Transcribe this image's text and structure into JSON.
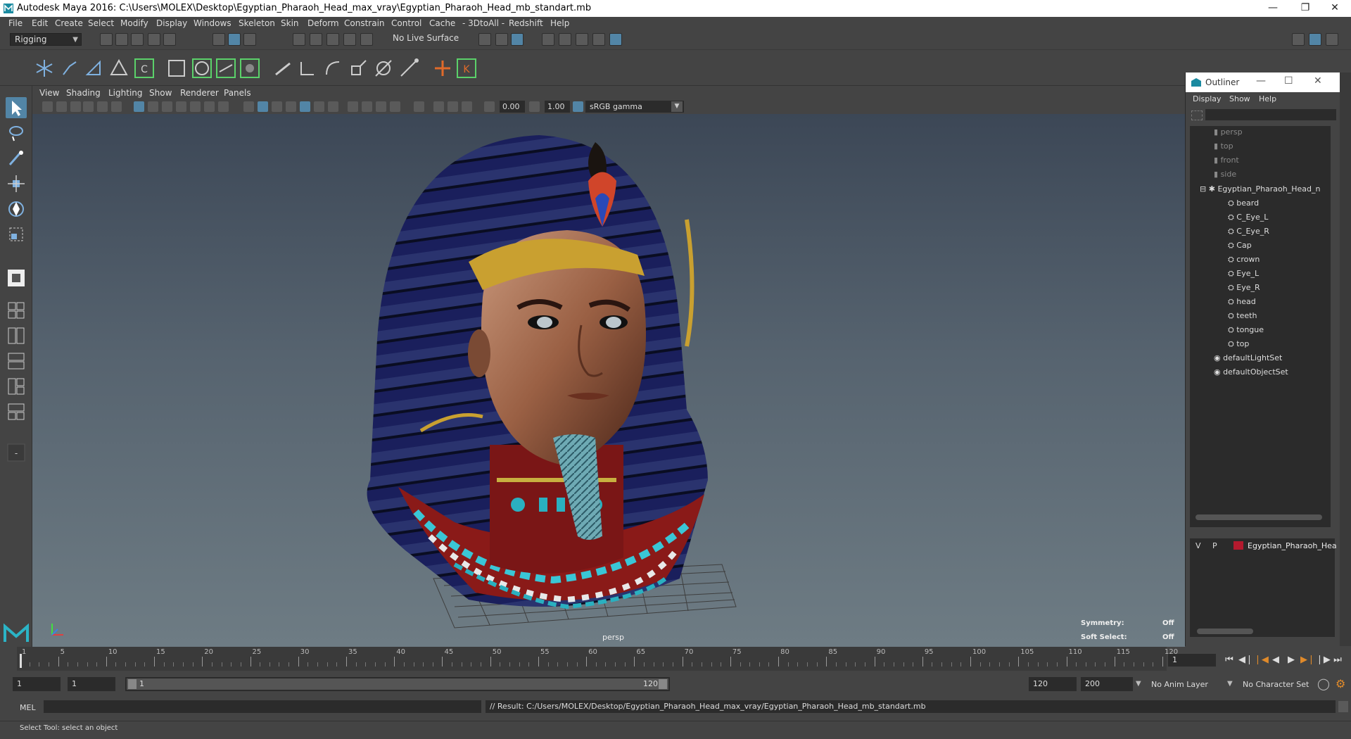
{
  "window": {
    "title": "Autodesk Maya 2016: C:\\Users\\MOLEX\\Desktop\\Egyptian_Pharaoh_Head_max_vray\\Egyptian_Pharaoh_Head_mb_standart.mb",
    "minimize_icon": "minimize-icon",
    "restore_icon": "restore-icon",
    "close_icon": "close-icon"
  },
  "menubar": [
    "File",
    "Edit",
    "Create",
    "Select",
    "Modify",
    "Display",
    "Windows",
    "Skeleton",
    "Skin",
    "Deform",
    "Constrain",
    "Control",
    "Cache",
    "- 3DtoAll -",
    "Redshift",
    "Help"
  ],
  "statusline": {
    "mode": "Rigging",
    "live_surface": "No Live Surface"
  },
  "viewport": {
    "menu": [
      "View",
      "Shading",
      "Lighting",
      "Show",
      "Renderer",
      "Panels"
    ],
    "exposure": "0.00",
    "gamma_value": "1.00",
    "color_space": "sRGB gamma",
    "camera_label": "persp",
    "hud": {
      "symmetry_label": "Symmetry:",
      "symmetry_value": "Off",
      "soft_select_label": "Soft Select:",
      "soft_select_value": "Off"
    },
    "colors": {
      "top": "#3c4756",
      "bottom": "#6e7c84"
    }
  },
  "outliner": {
    "title": "Outliner",
    "menu": [
      "Display",
      "Show",
      "Help"
    ],
    "cameras": [
      "persp",
      "top",
      "front",
      "side"
    ],
    "group": "Egyptian_Pharaoh_Head_n",
    "children": [
      "beard",
      "C_Eye_L",
      "C_Eye_R",
      "Cap",
      "crown",
      "Eye_L",
      "Eye_R",
      "head",
      "teeth",
      "tongue",
      "top"
    ],
    "sets": [
      "defaultLightSet",
      "defaultObjectSet"
    ]
  },
  "layer_editor": {
    "v": "V",
    "p": "P",
    "layer_name": "Egyptian_Pharaoh_Hea",
    "layer_color": "#b31a2e"
  },
  "timeslider": {
    "ticks": [
      "1",
      "5",
      "10",
      "15",
      "20",
      "25",
      "30",
      "35",
      "40",
      "45",
      "50",
      "55",
      "60",
      "65",
      "70",
      "75",
      "80",
      "85",
      "90",
      "95",
      "100",
      "105",
      "110",
      "115",
      "120"
    ],
    "current_frame": "1"
  },
  "range": {
    "start": "1",
    "playback_start": "1",
    "slider_start": "1",
    "slider_end": "120",
    "playback_end": "120",
    "end": "200",
    "anim_layer": "No Anim Layer",
    "character_set": "No Character Set"
  },
  "commandline": {
    "label": "MEL",
    "result": "// Result: C:/Users/MOLEX/Desktop/Egyptian_Pharaoh_Head_max_vray/Egyptian_Pharaoh_Head_mb_standart.mb"
  },
  "helpline": "Select Tool: select an object"
}
